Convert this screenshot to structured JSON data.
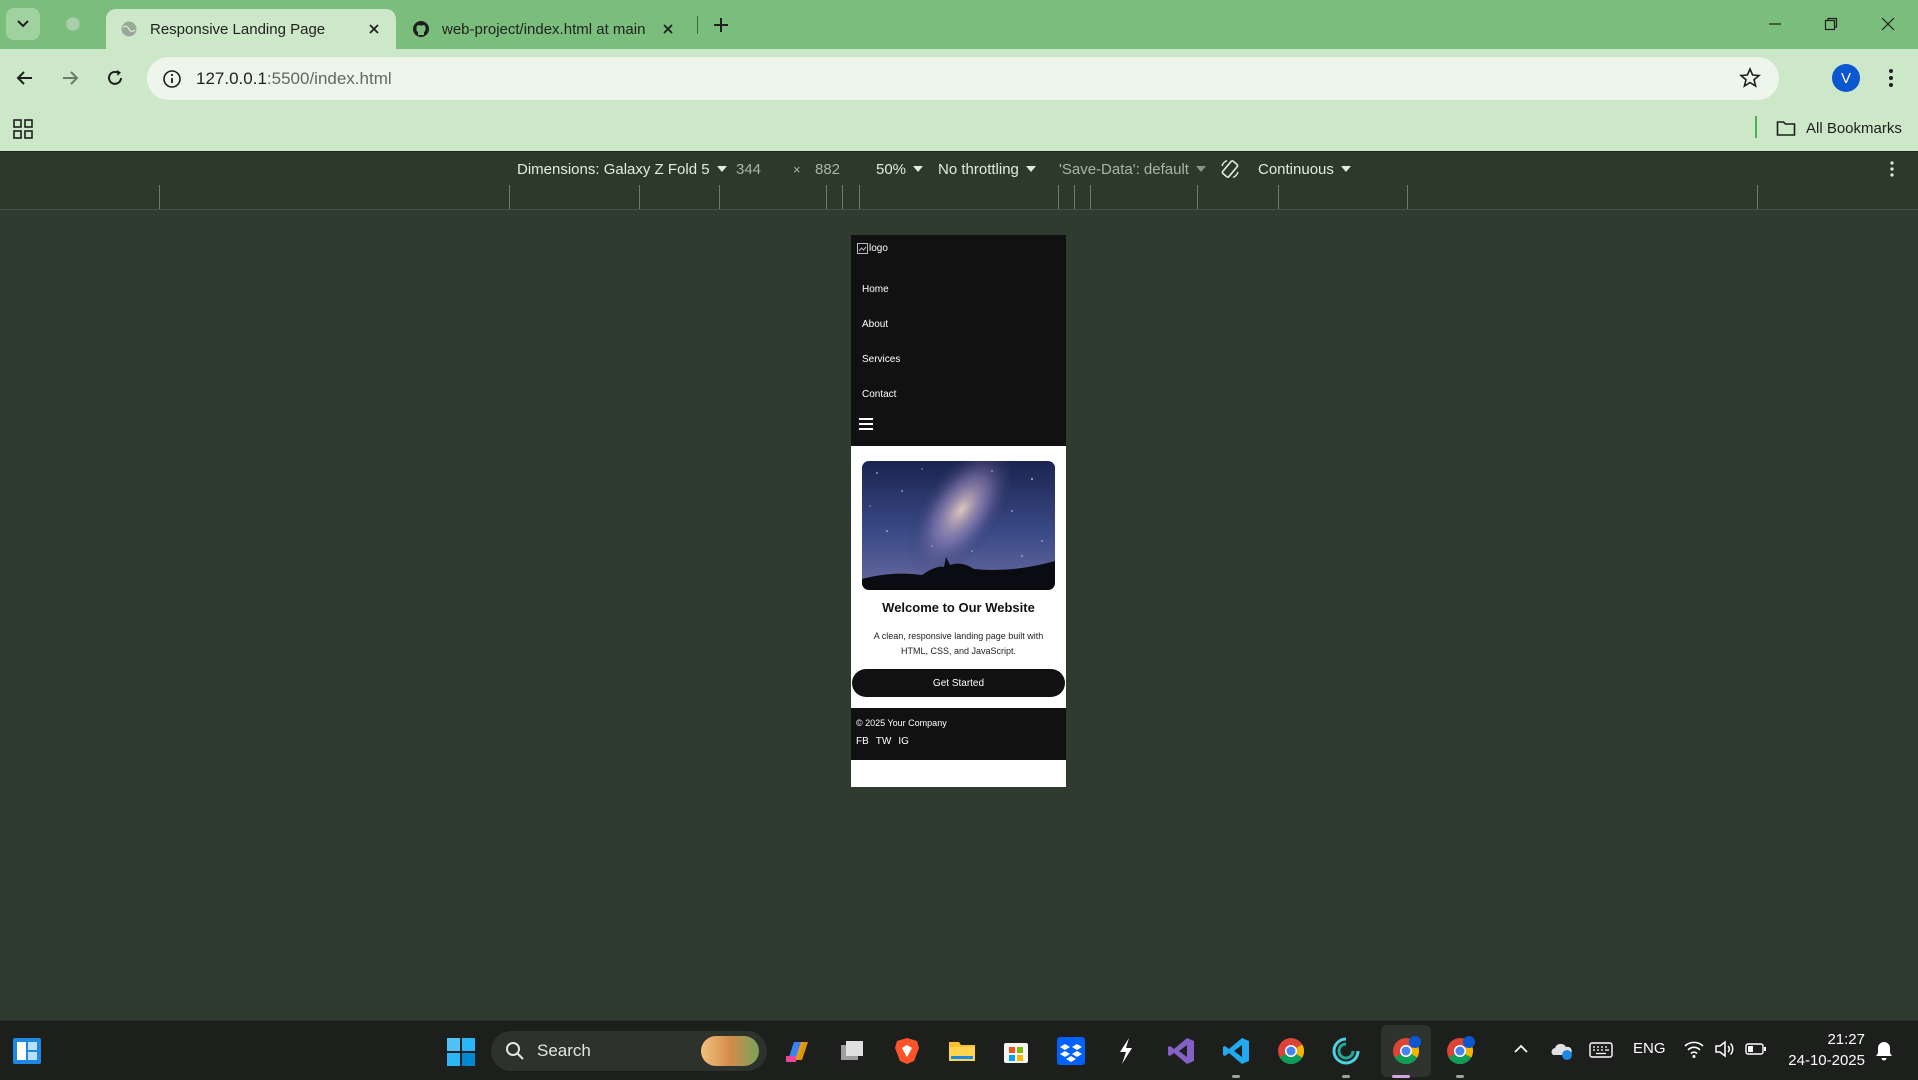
{
  "browser": {
    "tabs": [
      {
        "title": "Responsive Landing Page",
        "active": true,
        "favicon": "globe-icon"
      },
      {
        "title": "web-project/index.html at main",
        "active": false,
        "favicon": "github-icon"
      }
    ],
    "url_host": "127.0.0.1",
    "url_rest": ":5500/index.html",
    "profile_initial": "V",
    "bookmarks_label": "All Bookmarks"
  },
  "devtools": {
    "dimensions": "Dimensions: Galaxy Z Fold 5",
    "width": "344",
    "times": "×",
    "height": "882",
    "zoom": "50%",
    "throttling": "No throttling",
    "save_data": "'Save-Data': default",
    "mode": "Continuous"
  },
  "site": {
    "logo_alt": "logo",
    "nav": {
      "home": "Home",
      "about": "About",
      "services": "Services",
      "contact": "Contact"
    },
    "hero_title": "Welcome to Our Website",
    "hero_desc": "A clean, responsive landing page built with HTML, CSS, and JavaScript.",
    "cta": "Get Started",
    "footer_copy": "© 2025 Your Company",
    "social": {
      "fb": "FB",
      "tw": "TW",
      "ig": "IG"
    }
  },
  "taskbar": {
    "search_label": "Search",
    "language": "ENG",
    "time": "21:27",
    "date": "24-10-2025"
  },
  "colors": {
    "tabstrip": "#7bbd7c",
    "toolbar": "#cde8c8",
    "devtools": "#2c3a2b",
    "site_dark": "#111111"
  }
}
